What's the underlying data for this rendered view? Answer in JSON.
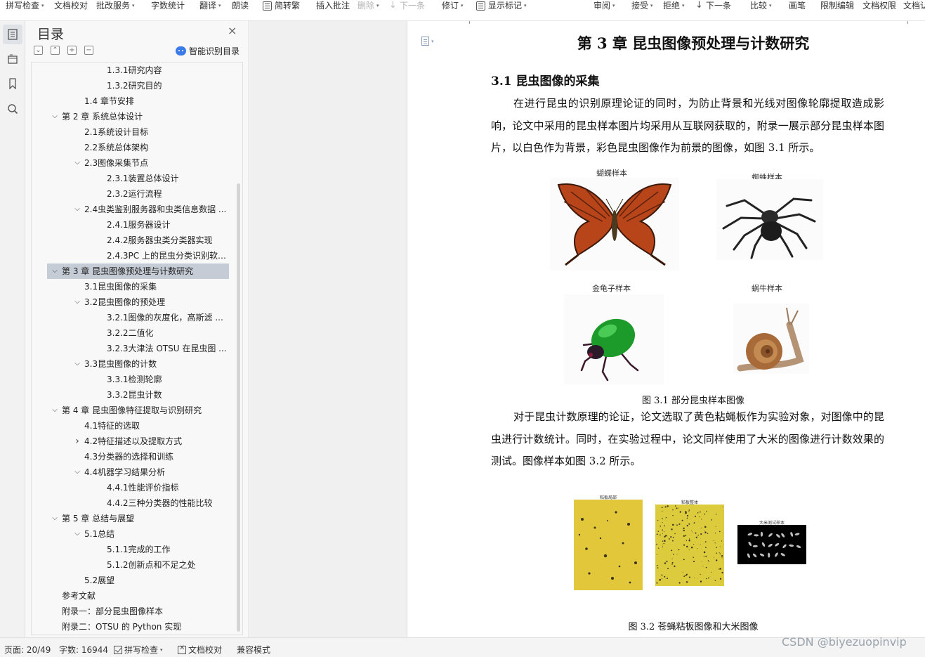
{
  "toolbar": {
    "items": [
      {
        "label": "拼写检查",
        "caret": true
      },
      {
        "label": "文档校对",
        "caret": false
      },
      {
        "label": "批改服务",
        "caret": true
      },
      {
        "label": "字数统计",
        "caret": false
      },
      {
        "label": "翻译",
        "caret": true
      },
      {
        "label": "朗读",
        "caret": false
      },
      {
        "label": "简转繁",
        "caret": false
      },
      {
        "label": "插入批注",
        "caret": false
      },
      {
        "label": "删除",
        "caret": true,
        "disabled": true
      },
      {
        "label": "下一条",
        "caret": false,
        "disabled": true
      },
      {
        "label": "修订",
        "caret": true
      },
      {
        "label": "显示标记",
        "caret": true
      },
      {
        "label": "审阅",
        "caret": true
      },
      {
        "label": "接受",
        "caret": true
      },
      {
        "label": "拒绝",
        "caret": true
      },
      {
        "label": "下一条",
        "caret": false
      },
      {
        "label": "比较",
        "caret": true
      },
      {
        "label": "画笔",
        "caret": false
      },
      {
        "label": "限制编辑",
        "caret": false
      },
      {
        "label": "文档权限",
        "caret": false
      },
      {
        "label": "文档认",
        "caret": false
      }
    ]
  },
  "sidebar_icons": [
    "toc-icon",
    "navigation-icon",
    "bookmark-icon",
    "search-icon"
  ],
  "toc": {
    "title": "目录",
    "close": "×",
    "smart_label": "智能识别目录",
    "items": [
      {
        "label": "1.3.1研究内容",
        "level": 3,
        "expand": "none"
      },
      {
        "label": "1.3.2研究目的",
        "level": 3,
        "expand": "none"
      },
      {
        "label": "1.4 章节安排",
        "level": 2,
        "expand": "none"
      },
      {
        "label": "第 2 章 系统总体设计",
        "level": 1,
        "expand": "open"
      },
      {
        "label": "2.1系统设计目标",
        "level": 2,
        "expand": "none"
      },
      {
        "label": "2.2系统总体架构",
        "level": 2,
        "expand": "none"
      },
      {
        "label": "2.3图像采集节点",
        "level": 2,
        "expand": "open"
      },
      {
        "label": "2.3.1装置总体设计",
        "level": 3,
        "expand": "none"
      },
      {
        "label": "2.3.2运行流程",
        "level": 3,
        "expand": "none"
      },
      {
        "label": "2.4虫类鉴别服务器和虫类信息数据 ...",
        "level": 2,
        "expand": "open"
      },
      {
        "label": "2.4.1服务器设计",
        "level": 3,
        "expand": "none"
      },
      {
        "label": "2.4.2服务器虫类分类器实现",
        "level": 3,
        "expand": "none"
      },
      {
        "label": "2.4.3PC 上的昆虫分类识别软 ...",
        "level": 3,
        "expand": "none"
      },
      {
        "label": "第 3 章 昆虫图像预处理与计数研究",
        "level": 1,
        "expand": "open",
        "selected": true
      },
      {
        "label": "3.1昆虫图像的采集",
        "level": 2,
        "expand": "none"
      },
      {
        "label": "3.2昆虫图像的预处理",
        "level": 2,
        "expand": "open"
      },
      {
        "label": "3.2.1图像的灰度化，高斯滤 ...",
        "level": 3,
        "expand": "none"
      },
      {
        "label": "3.2.2二值化",
        "level": 3,
        "expand": "none"
      },
      {
        "label": "3.2.3大津法 OTSU 在昆虫图 ...",
        "level": 3,
        "expand": "none"
      },
      {
        "label": "3.3昆虫图像的计数",
        "level": 2,
        "expand": "open"
      },
      {
        "label": "3.3.1检测轮廓",
        "level": 3,
        "expand": "none"
      },
      {
        "label": "3.3.2昆虫计数",
        "level": 3,
        "expand": "none"
      },
      {
        "label": "第 4 章 昆虫图像特征提取与识别研究",
        "level": 1,
        "expand": "open"
      },
      {
        "label": "4.1特征的选取",
        "level": 2,
        "expand": "none"
      },
      {
        "label": "4.2特征描述以及提取方式",
        "level": 2,
        "expand": "closed"
      },
      {
        "label": "4.3分类器的选择和训练",
        "level": 2,
        "expand": "none"
      },
      {
        "label": "4.4机器学习结果分析",
        "level": 2,
        "expand": "open"
      },
      {
        "label": "4.4.1性能评价指标",
        "level": 3,
        "expand": "none"
      },
      {
        "label": "4.4.2三种分类器的性能比较",
        "level": 3,
        "expand": "none"
      },
      {
        "label": "第 5 章 总结与展望",
        "level": 1,
        "expand": "open"
      },
      {
        "label": "5.1总结",
        "level": 2,
        "expand": "open"
      },
      {
        "label": "5.1.1完成的工作",
        "level": 3,
        "expand": "none"
      },
      {
        "label": "5.1.2创新点和不足之处",
        "level": 3,
        "expand": "none"
      },
      {
        "label": "5.2展望",
        "level": 2,
        "expand": "none"
      },
      {
        "label": "参考文献",
        "level": 1,
        "expand": "none"
      },
      {
        "label": "附录一：部分昆虫图像样本",
        "level": 1,
        "expand": "none"
      },
      {
        "label": "附录二：OTSU 的 Python 实现",
        "level": 1,
        "expand": "none"
      }
    ]
  },
  "document": {
    "chapter_title": "第 3 章  昆虫图像预处理与计数研究",
    "section_title": "3.1  昆虫图像的采集",
    "paragraph1": "在进行昆虫的识别原理论证的同时，为防止背景和光线对图像轮廓提取造成影响，论文中采用的昆虫样本图片均采用从互联网获取的，附录一展示部分昆虫样本图片，以白色作为背景，彩色昆虫图像作为前景的图像，如图 3.1 所示。",
    "figure1_labels": [
      "蝴蝶样本",
      "蜘蛛样本",
      "金龟子样本",
      "蜗牛样本"
    ],
    "figure1_caption": "图 3.1  部分昆虫样本图像",
    "paragraph2": "对于昆虫计数原理的论证，论文选取了黄色粘蝇板作为实验对象，对图像中的昆虫进行计数统计。同时，在实验过程中，论文同样使用了大米的图像进行计数效果的测试。图像样本如图 3.2 所示。",
    "figure2_labels": [
      "粘板局部",
      "粘板整体",
      "大米测试样本"
    ],
    "figure2_caption": "图 3.2  苍蝇粘板图像和大米图像"
  },
  "status": {
    "page": "页面: 20/49",
    "words": "字数: 16944",
    "spell": "拼写检查",
    "proof": "文档校对",
    "compat": "兼容模式"
  },
  "watermark": "CSDN @biyezuopinvip",
  "colors": {
    "selected_row": "#c5ccd6",
    "accent": "#3b7be8",
    "trap_yellow": "#e8d24a"
  }
}
